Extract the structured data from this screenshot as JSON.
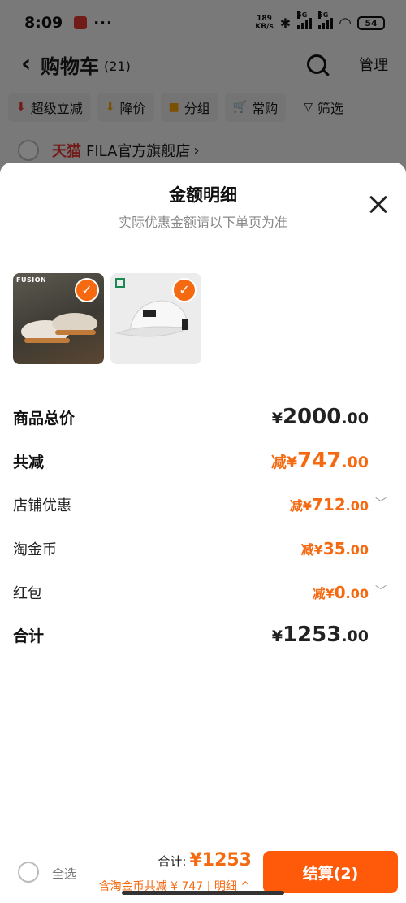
{
  "status_bar": {
    "time": "8:09",
    "dots": "···",
    "net_speed_value": "189",
    "net_speed_unit": "KB/s",
    "signal_label_1": "5G",
    "signal_label_2": "5G",
    "battery": "54"
  },
  "cart_header": {
    "title": "购物车",
    "count": "(21)",
    "manage_label": "管理"
  },
  "chips": [
    {
      "label": "超级立减",
      "icon": "red-down-arrow-icon",
      "color": "#e53935"
    },
    {
      "label": "降价",
      "icon": "orange-down-arrow-icon",
      "color": "#f5a300"
    },
    {
      "label": "分组",
      "icon": "folder-icon",
      "color": "#f5a300"
    },
    {
      "label": "常购",
      "icon": "cart-icon",
      "color": "#f5a300"
    },
    {
      "label": "筛选",
      "icon": "filter-icon",
      "color": "#222"
    }
  ],
  "shop": {
    "platform": "天猫",
    "name": "FILA官方旗舰店"
  },
  "sheet": {
    "title": "金额明细",
    "subtitle": "实际优惠金额请以下单页为准",
    "products": [
      {
        "name": "shoe",
        "brand_label": "FUSION",
        "selected": true
      },
      {
        "name": "cap",
        "selected": true
      }
    ],
    "rows": {
      "total_price": {
        "label": "商品总价",
        "prefix": "¥",
        "int": "2000",
        "dec": ".00"
      },
      "total_discount": {
        "label": "共减",
        "prefix": "减¥",
        "int": "747",
        "dec": ".00"
      },
      "shop_discount": {
        "label": "店铺优惠",
        "prefix": "减¥",
        "int": "712",
        "dec": ".00"
      },
      "coins": {
        "label": "淘金币",
        "prefix": "减¥",
        "int": "35",
        "dec": ".00"
      },
      "red_packet": {
        "label": "红包",
        "prefix": "减¥",
        "int": "0",
        "dec": ".00"
      },
      "grand_total": {
        "label": "合计",
        "prefix": "¥",
        "int": "1253",
        "dec": ".00"
      }
    }
  },
  "bottom_bar": {
    "select_all": "全选",
    "total_label": "合计:",
    "total_amount": "¥1253",
    "discount_detail": "含淘金币共减 ¥ 747 | 明细 ^",
    "checkout_label": "结算(2)"
  },
  "colors": {
    "accent": "#f56a11",
    "checkout": "#ff5a0a",
    "tmall_red": "#e53935"
  }
}
